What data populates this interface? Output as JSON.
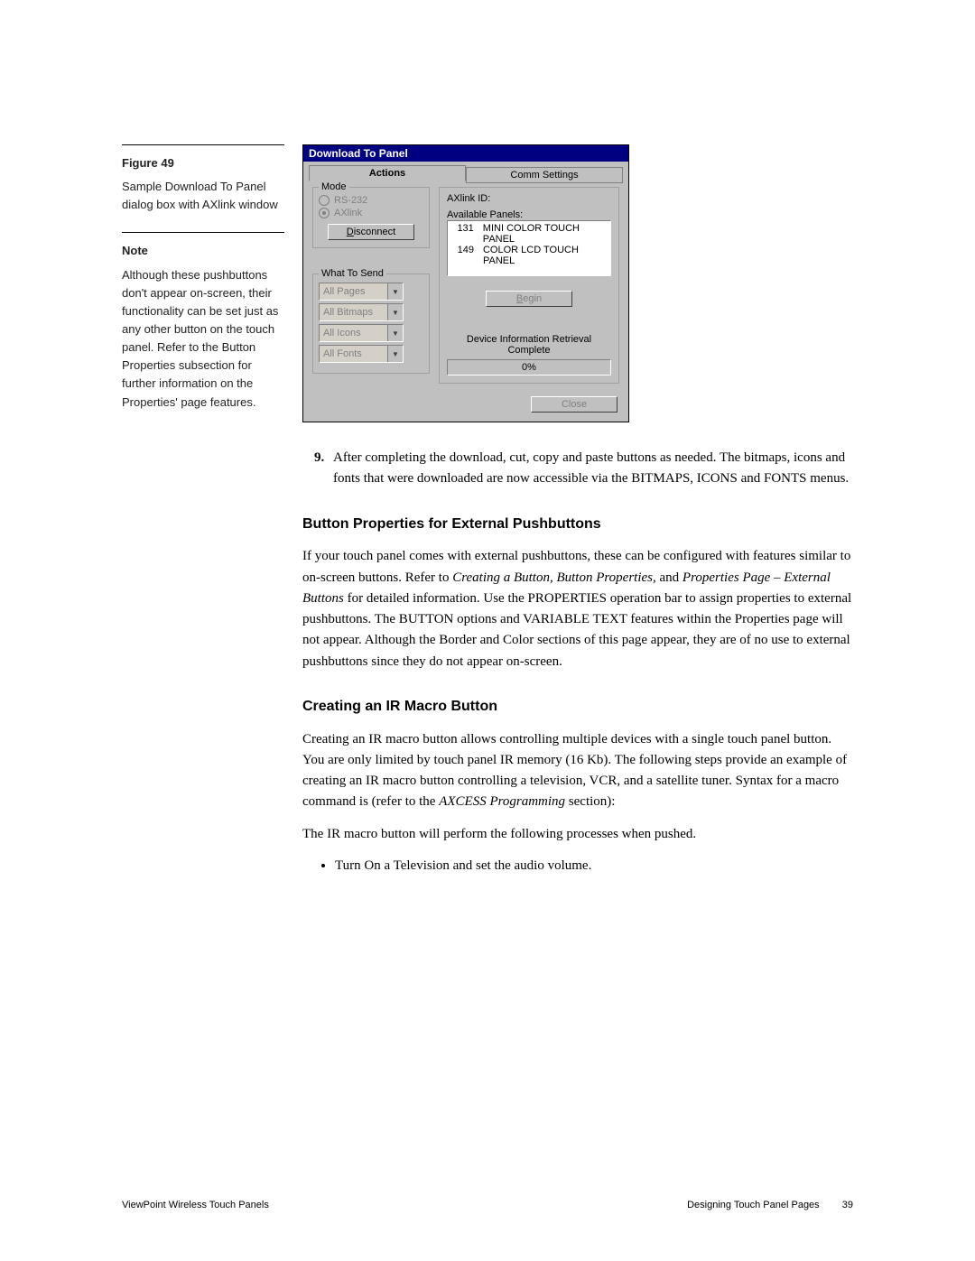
{
  "sidebar": {
    "figure_label": "Figure 49",
    "figure_caption": "Sample Download To Panel dialog box with AXlink window",
    "note_label": "Note",
    "note_body": "Although these pushbuttons don't appear on-screen, their functionality can be set just as any other button on the touch panel. Refer to the Button Properties subsection for further information on the Properties' page features."
  },
  "dialog": {
    "title": "Download To Panel",
    "tabs": {
      "actions": "Actions",
      "comm": "Comm Settings"
    },
    "mode": {
      "legend": "Mode",
      "rs232": "RS-232",
      "axlink": "AXlink",
      "disconnect": "Disconnect",
      "disconnect_u_index": 0
    },
    "what_to_send": {
      "legend": "What To Send",
      "combos": [
        "All Pages",
        "All Bitmaps",
        "All Icons",
        "All Fonts"
      ]
    },
    "axlink_id_label": "AXlink ID:",
    "available_label": "Available Panels:",
    "panels": [
      {
        "id": "131",
        "name": "MINI COLOR TOUCH PANEL"
      },
      {
        "id": "149",
        "name": "COLOR LCD TOUCH PANEL"
      }
    ],
    "begin": "Begin",
    "status": "Device Information Retrieval Complete",
    "progress": "0%",
    "close": "Close"
  },
  "prose": {
    "step9_num": "9.",
    "step9": "After completing the download, cut, copy and paste buttons as needed. The bitmaps, icons and fonts that were downloaded are now accessible via the BITMAPS, ICONS and FONTS menus.",
    "h_button_props": "Button Properties for External Pushbuttons",
    "p1a": "If your touch panel comes with external pushbuttons, these can be configured with features similar to on-screen buttons. Refer to ",
    "p1i1": "Creating a Button, Button Properties,",
    "p1b": " and ",
    "p1i2": "Properties Page – External Buttons",
    "p1c": " for detailed information. Use the PROPERTIES operation bar to assign properties to external pushbuttons. The BUTTON options and VARIABLE TEXT features within the Properties page will not appear. Although the Border and Color sections of this page appear, they are of no use to external pushbuttons since they do not appear on-screen.",
    "h_ir": "Creating an IR Macro Button",
    "p2a": "Creating an IR macro button allows controlling multiple devices with a single touch panel button. You are only limited by touch panel IR memory (16 Kb). The following steps provide an example of creating an IR macro button controlling a television, VCR, and a satellite tuner. Syntax for a macro command is (refer to the ",
    "p2i": "AXCESS Programming",
    "p2b": " section):",
    "p3": "The IR macro button will perform the following processes when pushed.",
    "bullet1": "Turn On a Television and set the audio volume."
  },
  "footer": {
    "left": "ViewPoint Wireless Touch Panels",
    "right": "Designing Touch Panel Pages",
    "page": "39"
  }
}
